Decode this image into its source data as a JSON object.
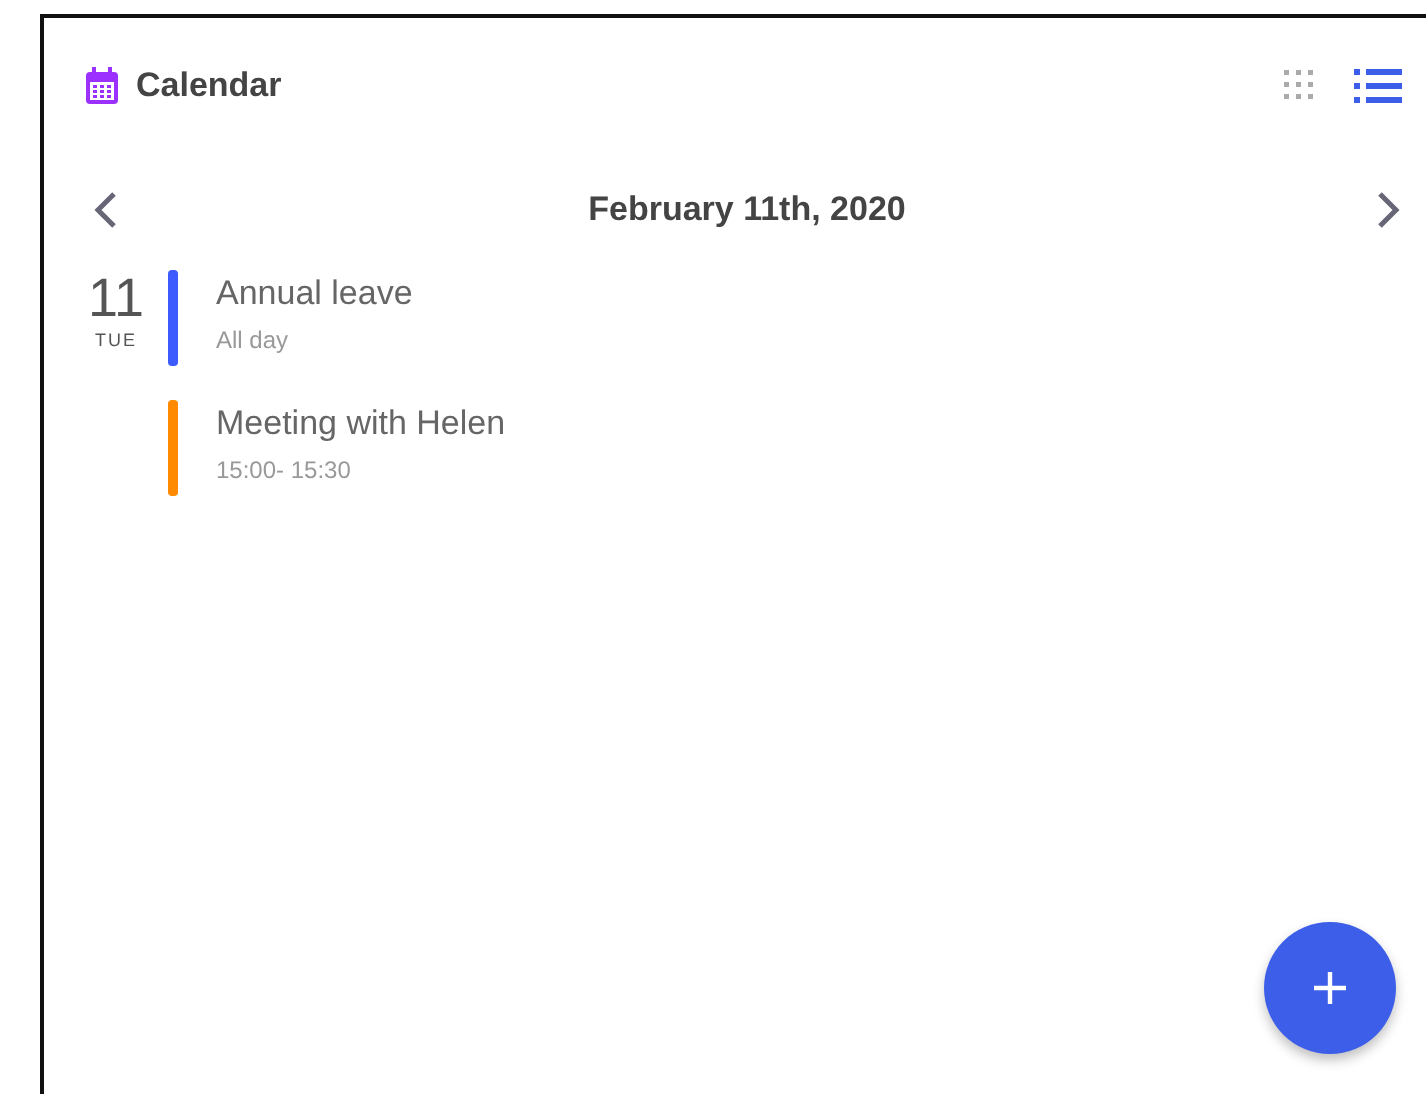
{
  "header": {
    "title": "Calendar",
    "view_options": [
      {
        "kind": "grid",
        "selected": false
      },
      {
        "kind": "list",
        "selected": true
      }
    ]
  },
  "date_nav": {
    "label": "February 11th, 2020"
  },
  "day": {
    "number": "11",
    "weekday": "TUE",
    "events": [
      {
        "title": "Annual leave",
        "time": "All day",
        "color": "#3d5afe"
      },
      {
        "title": "Meeting with Helen",
        "time": "15:00- 15:30",
        "color": "#ff8a00"
      }
    ]
  }
}
